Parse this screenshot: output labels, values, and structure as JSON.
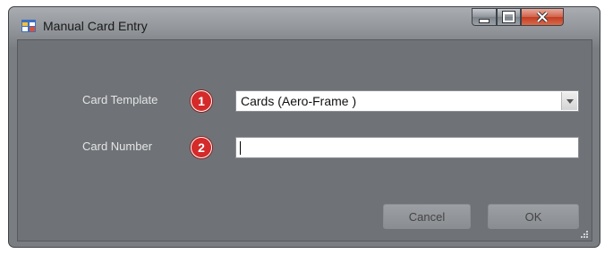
{
  "window": {
    "title": "Manual Card Entry"
  },
  "form": {
    "card_template_label": "Card Template",
    "card_template_value": "Cards (Aero-Frame )",
    "card_number_label": "Card Number",
    "card_number_value": ""
  },
  "markers": {
    "one": "1",
    "two": "2"
  },
  "buttons": {
    "cancel": "Cancel",
    "ok": "OK"
  },
  "icons": {
    "app": "window-app-icon",
    "minimize": "minimize-icon",
    "maximize": "maximize-icon",
    "close": "close-icon",
    "dropdown": "chevron-down-icon",
    "grip": "resize-grip-icon"
  },
  "colors": {
    "marker": "#d42a2a",
    "close_button": "#c94a2f"
  }
}
